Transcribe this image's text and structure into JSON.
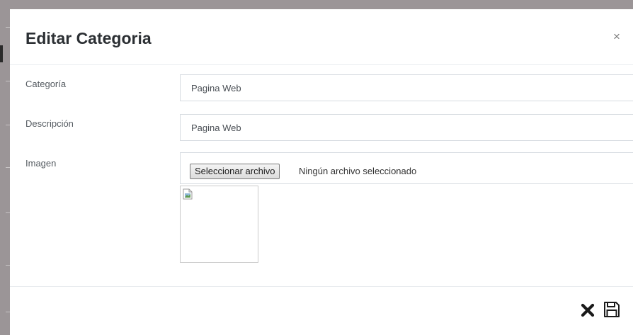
{
  "modal": {
    "title": "Editar Categoria",
    "close_label": "×"
  },
  "form": {
    "categoria": {
      "label": "Categoría",
      "value": "Pagina Web"
    },
    "descripcion": {
      "label": "Descripción",
      "value": "Pagina Web"
    },
    "imagen": {
      "label": "Imagen",
      "button_label": "Seleccionar archivo",
      "status": "Ningún archivo seleccionado"
    }
  },
  "footer": {
    "cancel_icon": "times-icon",
    "save_icon": "floppy-disk-icon"
  },
  "colors": {
    "backdrop": "#9b9597",
    "title": "#2b2f33",
    "label": "#555b61",
    "input_border": "#d6dbe0"
  }
}
